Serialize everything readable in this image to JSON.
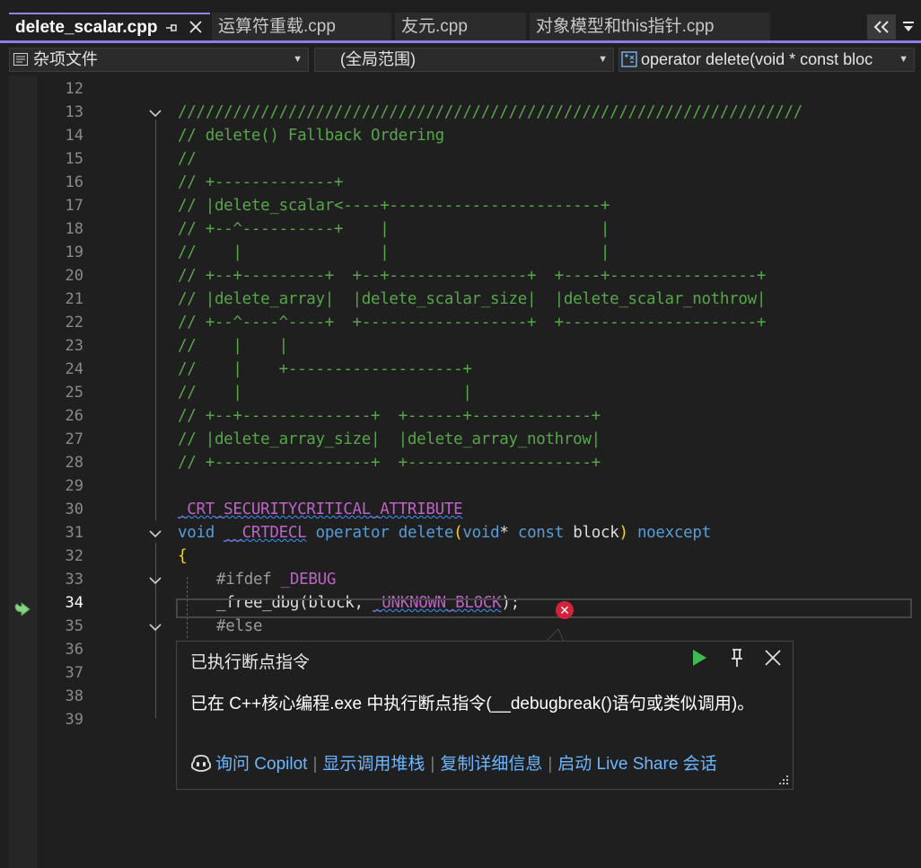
{
  "tabs": [
    {
      "label": "delete_scalar.cpp",
      "active": true
    },
    {
      "label": "运算符重载.cpp",
      "active": false
    },
    {
      "label": "友元.cpp",
      "active": false
    },
    {
      "label": "对象模型和this指针.cpp",
      "active": false
    }
  ],
  "tab_controls": {
    "pin_icon": "pin-icon",
    "close_icon": "close-icon",
    "overflow_icon": "chevrons-left-icon",
    "menu_icon": "dropdown-icon"
  },
  "navbar": {
    "project": "杂项文件",
    "scope": "(全局范围)",
    "member": "operator delete(void * const bloc"
  },
  "code_lines": [
    {
      "num": "12"
    },
    {
      "num": "13",
      "text": "////////////////////////////////////////////////////////////////////"
    },
    {
      "num": "14",
      "text": "// delete() Fallback Ordering"
    },
    {
      "num": "15",
      "text": "//"
    },
    {
      "num": "16",
      "text": "// +-------------+"
    },
    {
      "num": "17",
      "text": "// |delete_scalar<----+-----------------------+"
    },
    {
      "num": "18",
      "text": "// +--^----------+    |                       |"
    },
    {
      "num": "19",
      "text": "//    |               |                       |"
    },
    {
      "num": "20",
      "text": "// +--+---------+  +--+---------------+  +----+----------------+"
    },
    {
      "num": "21",
      "text": "// |delete_array|  |delete_scalar_size|  |delete_scalar_nothrow|"
    },
    {
      "num": "22",
      "text": "// +--^----^----+  +------------------+  +---------------------+"
    },
    {
      "num": "23",
      "text": "//    |    |"
    },
    {
      "num": "24",
      "text": "//    |    +-------------------+"
    },
    {
      "num": "25",
      "text": "//    |                        |"
    },
    {
      "num": "26",
      "text": "// +--+--------------+  +------+-------------+"
    },
    {
      "num": "27",
      "text": "// |delete_array_size|  |delete_array_nothrow|"
    },
    {
      "num": "28",
      "text": "// +-----------------+  +--------------------+"
    },
    {
      "num": "29"
    },
    {
      "num": "30",
      "text": "_CRT_SECURITYCRITICAL_ATTRIBUTE"
    },
    {
      "num": "31",
      "t1": "void",
      "t2": "__CRTDECL",
      "t3": "operator",
      "t4": "delete",
      "t5": "(",
      "t6": "void",
      "t7": "* ",
      "t8": "const",
      "t9": " block",
      "t10": ")",
      "t11": "noexcept"
    },
    {
      "num": "32",
      "text": "{"
    },
    {
      "num": "33",
      "t1": "#ifdef",
      "t2": " _DEBUG"
    },
    {
      "num": "34",
      "t1": "_free_dbg",
      "t2": "(block, ",
      "t3": "_UNKNOWN_BLOCK",
      "t4": ");"
    },
    {
      "num": "35",
      "text": "#else"
    },
    {
      "num": "36"
    },
    {
      "num": "37"
    },
    {
      "num": "38"
    },
    {
      "num": "39"
    }
  ],
  "current_line": "34",
  "exception_popup": {
    "title": "已执行断点指令",
    "message": "已在 C++核心编程.exe 中执行断点指令(__debugbreak()语句或类似调用)。",
    "links": [
      "询问 Copilot",
      "显示调用堆栈",
      "复制详细信息",
      "启动 Live Share 会话"
    ],
    "continue_icon": "play-icon",
    "pin_icon": "pin-icon",
    "close_icon": "close-icon",
    "copilot_icon": "copilot-icon"
  },
  "colors": {
    "background": "#1f1f1f",
    "comment": "#57a64a",
    "keyword": "#569cd6",
    "preprocessor": "#9b9b9b",
    "macro": "#bd63c5",
    "brace": "#ffd700",
    "link": "#6cb6ff",
    "error": "#d3233b",
    "accent": "#8a7fe8"
  }
}
